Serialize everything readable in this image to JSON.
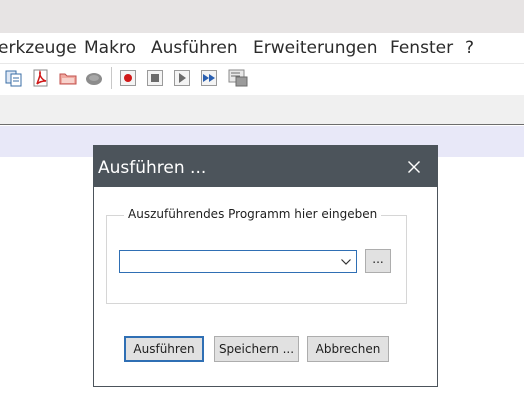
{
  "menu": {
    "items": [
      "erkzeuge",
      "Makro",
      "Ausführen",
      "Erweiterungen",
      "Fenster",
      "?"
    ]
  },
  "toolbar": {
    "icons": [
      "document-copy-icon",
      "pdf-icon",
      "folder-icon",
      "gear-icon",
      "record-macro-icon",
      "stop-macro-icon",
      "play-macro-icon",
      "fast-forward-macro-icon",
      "save-macro-icon"
    ]
  },
  "dialog": {
    "title": "Ausführen ...",
    "group_label": "Auszuführendes Programm hier eingeben",
    "command_value": "",
    "browse_label": "...",
    "buttons": {
      "run": "Ausführen",
      "save": "Speichern ...",
      "cancel": "Abbrechen"
    }
  },
  "colors": {
    "dialog_title_bar": "#4c545b",
    "focus_border": "#2f6fb4",
    "editor_current_line": "#e8e8f8"
  }
}
